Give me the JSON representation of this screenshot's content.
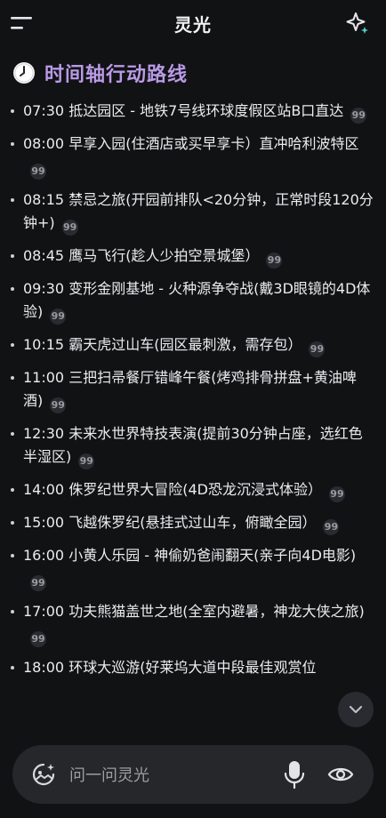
{
  "app": {
    "title": "灵光"
  },
  "header": {
    "icons": [
      "menu-icon",
      "sparkle-icon"
    ]
  },
  "section": {
    "icon": "clock-icon",
    "title": "时间轴行动路线"
  },
  "timeline": [
    {
      "text": "07:30 抵达园区 - 地铁7号线环球度假区站B口直达"
    },
    {
      "text": "08:00 早享入园(住酒店或买早享卡）直冲哈利波特区"
    },
    {
      "text": "08:15 禁忌之旅(开园前排队<20分钟，正常时段120分钟+)"
    },
    {
      "text": "08:45 鹰马飞行(趁人少拍空景城堡）"
    },
    {
      "text": "09:30 变形金刚基地 - 火种源争夺战(戴3D眼镜的4D体验)"
    },
    {
      "text": "10:15 霸天虎过山车(园区最刺激，需存包）"
    },
    {
      "text": "11:00 三把扫帚餐厅错峰午餐(烤鸡排骨拼盘+黄油啤酒)"
    },
    {
      "text": "12:30 未来水世界特技表演(提前30分钟占座，选红色半湿区)"
    },
    {
      "text": "14:00 侏罗纪世界大冒险(4D恐龙沉浸式体验）"
    },
    {
      "text": "15:00 飞越侏罗纪(悬挂式过山车，俯瞰全园）"
    },
    {
      "text": "16:00 小黄人乐园 - 神偷奶爸闹翻天(亲子向4D电影)"
    },
    {
      "text": "17:00 功夫熊猫盖世之地(全室内避暑，神龙大侠之旅)"
    },
    {
      "text": "18:00 环球大巡游(好莱坞大道中段最佳观赏位"
    }
  ],
  "input": {
    "placeholder": "问一问灵光"
  }
}
